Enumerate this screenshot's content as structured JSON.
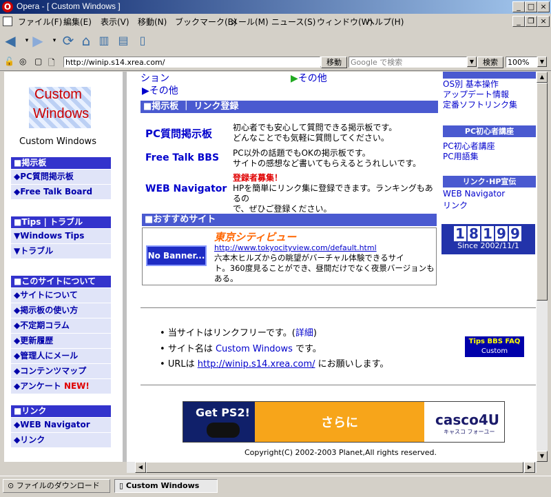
{
  "window": {
    "title": "Opera - [ Custom Windows ]",
    "logo_letter": "O",
    "min_glyph": "_",
    "max_glyph": "□",
    "close_glyph": "×",
    "restore_glyph": "❐"
  },
  "menu": {
    "items": [
      "ファイル(F)",
      "編集(E)",
      "表示(V)",
      "移動(N)",
      "ブックマーク(B)",
      "メール(M)",
      "ニュース(S)",
      "ウィンドウ(W)",
      "ヘルプ(H)"
    ]
  },
  "address": {
    "url": "http://winip.s14.xrea.com/",
    "go_label": "移動",
    "search_placeholder": "Google で検索",
    "search_label": "検索",
    "zoom": "100%"
  },
  "site": {
    "logo_line1": "Custom",
    "logo_line2": "Windows",
    "logo_caption": "Custom Windows"
  },
  "left_nav": {
    "bbs": {
      "title": "■掲示板",
      "items": [
        "◆PC質問掲示板",
        "◆Free Talk Board"
      ]
    },
    "tips": {
      "title": "■Tips | トラブル",
      "items": [
        "▼Windows Tips",
        "▼トラブル"
      ]
    },
    "about": {
      "title": "■このサイトについて",
      "items": [
        "◆サイトについて",
        "◆掲示板の使い方",
        "◆不定期コラム",
        "◆更新履歴",
        "◆管理人にメール",
        "◆コンテンツマップ",
        "◆アンケート"
      ],
      "new_label": "NEW!"
    },
    "links": {
      "title": "■リンク",
      "items": [
        "◆WEB Navigator",
        "◆リンク"
      ]
    }
  },
  "main": {
    "top_partial1": "ション",
    "top_partial2": "その他",
    "top_link": "▶その他",
    "bbs_bar": "■掲示板 ｜ リンク登録",
    "bbs_entries": [
      {
        "name": "PC質問掲示板",
        "desc1": "初心者でも安心して質問できる掲示板です。",
        "desc2": "どんなことでも気軽に質問してください。"
      },
      {
        "name": "Free Talk BBS",
        "desc1": "PC以外の話題でもOKの掲示板です。",
        "desc2": "サイトの感想など書いてもらえるとうれしいです。"
      },
      {
        "name": "WEB Navigator",
        "highlight": "登録者募集！",
        "desc1": "HPを簡単にリンク集に登録できます。ランキングもあるの",
        "desc2": "で、ぜひご登録ください。"
      }
    ],
    "recommend_bar": "■おすすめサイト",
    "recommend": {
      "banner": "No Banner...",
      "name": "東京シティビュー",
      "url": "http://www.tokyocityview.com/default.html",
      "desc1": "六本木ヒルズからの眺望がバーチャル体験できるサイ",
      "desc2": "ト。360度見ることができ、昼間だけでなく夜景バージョンも",
      "desc3": "ある。"
    },
    "notes": {
      "n1_pre": "当サイトはリンクフリーです。(",
      "n1_link": "詳細",
      "n1_post": ")",
      "n2_pre": "サイト名は ",
      "n2_link": "Custom Windows",
      "n2_post": " です。",
      "n3_pre": "URLは ",
      "n3_link": "http://winip.s14.xrea.com/",
      "n3_post": " にお願いします。"
    },
    "faq_badge1": "Tips BBS FAQ",
    "faq_badge2": "Custom Windows",
    "ad": {
      "left": "Get PS2!",
      "center": "さらに",
      "brand": "casco4U",
      "brand_sub": "キャスコ フォーユー"
    },
    "copyright": "Copyright(C) 2002-2003 Planet,All rights reserved."
  },
  "right_col": {
    "top_links": [
      "OS別 基本操作",
      "アップデート情報",
      "定番ソフトリンク集"
    ],
    "beginner_head": "PC初心者講座",
    "beginner_links": [
      "PC初心者講座",
      "PC用語集"
    ],
    "link_head": "リンク･HP宣伝",
    "link_links": [
      "WEB Navigator",
      "リンク"
    ],
    "counter_digits": [
      "1",
      "8",
      "1",
      "9",
      "9"
    ],
    "counter_since": "Since 2002/11/1"
  },
  "status": {
    "download_label": "ファイルのダウンロード",
    "tab_label": "Custom Windows"
  }
}
